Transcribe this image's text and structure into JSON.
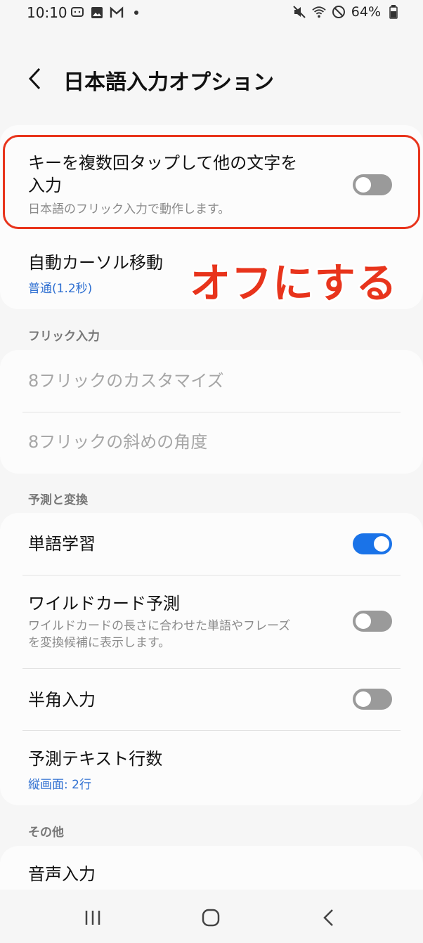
{
  "status_bar": {
    "time": "10:10",
    "battery": "64%",
    "left_icons": [
      "chat-icon",
      "image-icon",
      "gmail-icon",
      "dot-icon"
    ],
    "right_icons": [
      "mute-icon",
      "wifi-icon",
      "no-disturb-icon",
      "battery-icon"
    ]
  },
  "header": {
    "title": "日本語入力オプション"
  },
  "settings": {
    "multi_tap": {
      "title_line1": "キーを複数回タップして他の文字を",
      "title_line2": "入力",
      "subtitle": "日本語のフリック入力で動作します。",
      "enabled": false
    },
    "auto_cursor": {
      "title": "自動カーソル移動",
      "value": "普通(1.2秒)"
    }
  },
  "annotation": {
    "text": "オフにする",
    "color": "#e8341c"
  },
  "sections": {
    "flick": {
      "header": "フリック入力",
      "items": [
        {
          "title": "8フリックのカスタマイズ"
        },
        {
          "title": "8フリックの斜めの角度"
        }
      ]
    },
    "prediction": {
      "header": "予測と変換",
      "word_learning": {
        "title": "単語学習",
        "enabled": true
      },
      "wildcard": {
        "title": "ワイルドカード予測",
        "subtitle_line1": "ワイルドカードの長さに合わせた単語やフレーズ",
        "subtitle_line2": "を変換候補に表示します。",
        "enabled": false
      },
      "half_width": {
        "title": "半角入力",
        "enabled": false
      },
      "lines": {
        "title": "予測テキスト行数",
        "value": "縦画面: 2行"
      }
    },
    "other": {
      "header": "その他",
      "voice": {
        "title": "音声入力"
      }
    }
  },
  "colors": {
    "accent": "#1a73e8",
    "link": "#2e6fd1",
    "highlight": "#e8341c"
  }
}
